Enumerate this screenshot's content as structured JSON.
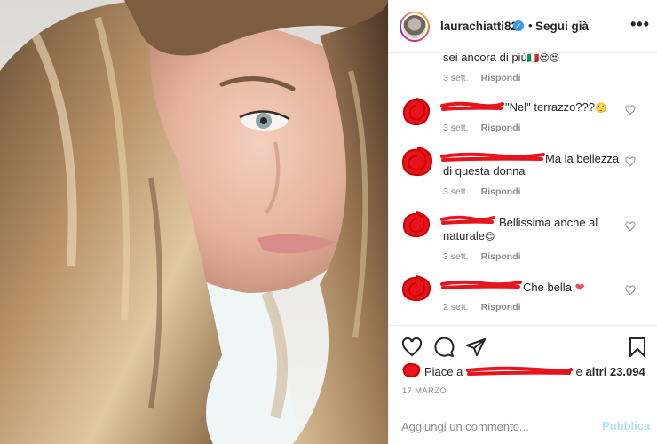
{
  "post": {
    "username": "laurachiatti82",
    "follow_separator": "•",
    "follow_label": "Segui già",
    "more_label": "•••"
  },
  "comments": [
    {
      "text_top": "sei ancora di più",
      "emoji": "🇮🇹😍😍",
      "time": "3 sett.",
      "reply": "Rispondi"
    },
    {
      "text": "\"Nel\" terrazzo???",
      "emoji": "🙄",
      "time": "3 sett.",
      "reply": "Rispondi"
    },
    {
      "text": "Ma la bellezza",
      "text2": "di questa donna",
      "time": "3 sett.",
      "reply": "Rispondi"
    },
    {
      "text": "Bellissima anche al",
      "text2": "naturale",
      "emoji": "😊",
      "time": "3 sett.",
      "reply": "Rispondi"
    },
    {
      "text": "Che bella",
      "emoji": "❤",
      "time": "2 sett.",
      "reply": "Rispondi"
    }
  ],
  "likes": {
    "prefix": "Piace a",
    "and": "e",
    "others": "altri 23.094"
  },
  "date": "17 MARZO",
  "comment_box": {
    "placeholder": "Aggiungi un commento...",
    "publish_label": "Pubblica"
  },
  "icons": {
    "like": "heart-icon",
    "comment": "comment-icon",
    "share": "share-icon",
    "save": "bookmark-icon",
    "verified": "verified-badge-icon"
  },
  "colors": {
    "redaction": "#e8141c",
    "verified": "#3897f0",
    "publish_disabled": "#b2dffc",
    "heart_red": "#ed4956"
  }
}
